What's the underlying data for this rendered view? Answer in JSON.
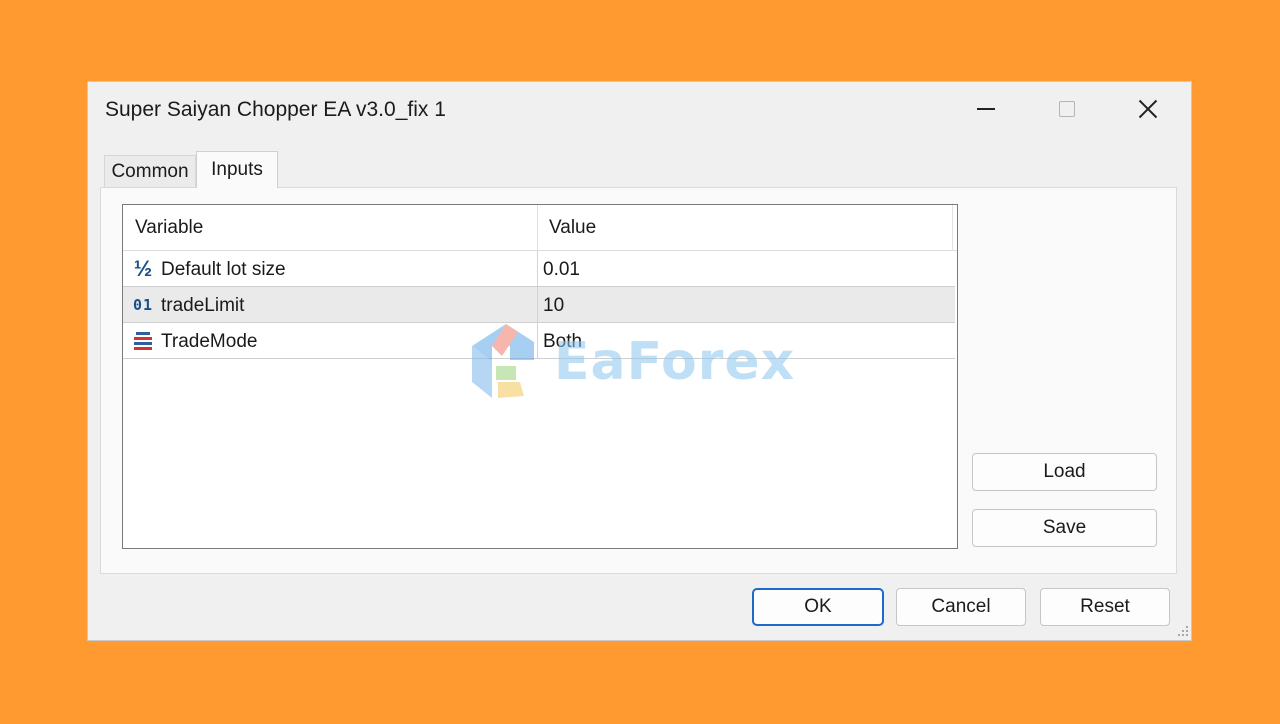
{
  "window": {
    "title": "Super Saiyan Chopper EA v3.0_fix 1"
  },
  "tabs": [
    {
      "label": "Common",
      "active": false
    },
    {
      "label": "Inputs",
      "active": true
    }
  ],
  "grid": {
    "columns": [
      "Variable",
      "Value"
    ],
    "rows": [
      {
        "icon": "fraction-icon",
        "variable": "Default lot size",
        "value": "0.01",
        "selected": false
      },
      {
        "icon": "integer-icon",
        "variable": "tradeLimit",
        "value": "10",
        "selected": true
      },
      {
        "icon": "enum-icon",
        "variable": "TradeMode",
        "value": "Both",
        "selected": false
      }
    ]
  },
  "side_buttons": {
    "load": "Load",
    "save": "Save"
  },
  "footer_buttons": {
    "ok": "OK",
    "cancel": "Cancel",
    "reset": "Reset"
  },
  "watermark": {
    "text": "EaForex"
  },
  "colors": {
    "background": "#FF9A30",
    "ok_border": "#1d6bc8",
    "icon_blue": "#1a4f8a",
    "icon_red": "#d0342c"
  }
}
